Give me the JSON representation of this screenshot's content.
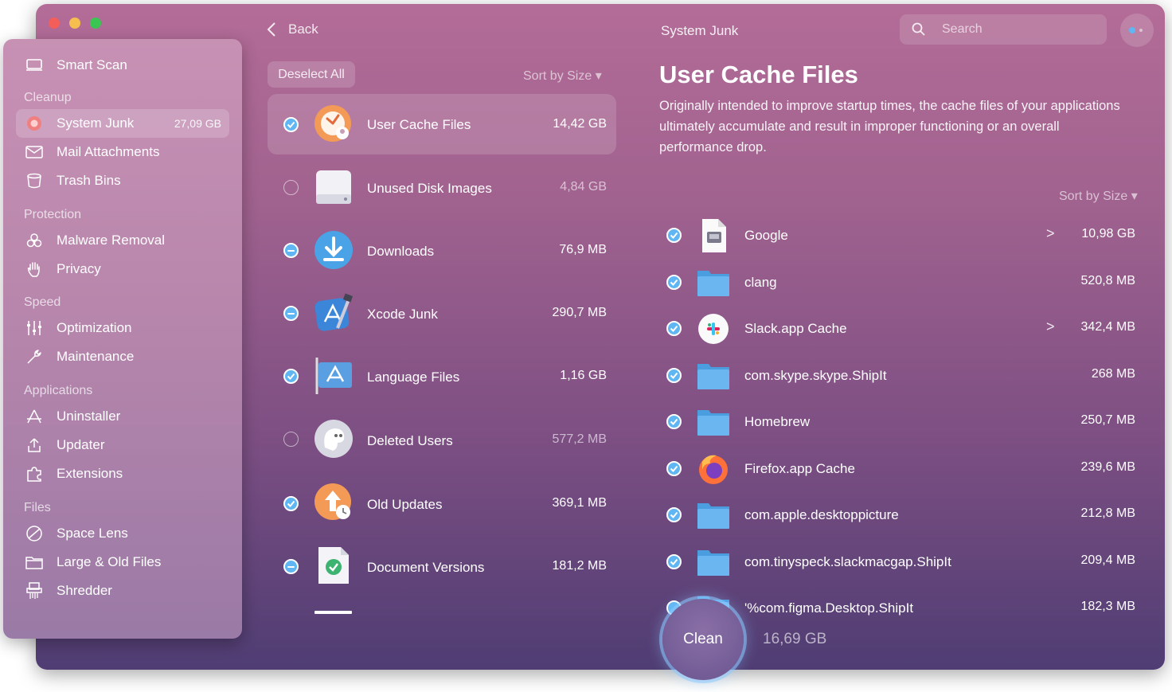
{
  "window": {
    "title": "System Junk",
    "back_label": "Back"
  },
  "search": {
    "placeholder": "Search"
  },
  "sidebar": {
    "smart_scan": "Smart Scan",
    "sections": [
      {
        "header": "Cleanup",
        "items": [
          {
            "label": "System Junk",
            "badge": "27,09 GB",
            "icon": "system-junk-icon"
          },
          {
            "label": "Mail Attachments",
            "icon": "mail-icon"
          },
          {
            "label": "Trash Bins",
            "icon": "trash-icon"
          }
        ]
      },
      {
        "header": "Protection",
        "items": [
          {
            "label": "Malware Removal",
            "icon": "biohazard-icon"
          },
          {
            "label": "Privacy",
            "icon": "hand-icon"
          }
        ]
      },
      {
        "header": "Speed",
        "items": [
          {
            "label": "Optimization",
            "icon": "sliders-icon"
          },
          {
            "label": "Maintenance",
            "icon": "wrench-icon"
          }
        ]
      },
      {
        "header": "Applications",
        "items": [
          {
            "label": "Uninstaller",
            "icon": "uninstaller-icon"
          },
          {
            "label": "Updater",
            "icon": "updater-icon"
          },
          {
            "label": "Extensions",
            "icon": "extensions-icon"
          }
        ]
      },
      {
        "header": "Files",
        "items": [
          {
            "label": "Space Lens",
            "icon": "space-lens-icon"
          },
          {
            "label": "Large & Old Files",
            "icon": "folder-icon"
          },
          {
            "label": "Shredder",
            "icon": "shredder-icon"
          }
        ]
      }
    ]
  },
  "categories": {
    "deselect_label": "Deselect All",
    "sort_label": "Sort by Size ▾",
    "items": [
      {
        "name": "User Cache Files",
        "size": "14,42 GB",
        "state": "on",
        "selected": true
      },
      {
        "name": "Unused Disk Images",
        "size": "4,84 GB",
        "state": "off"
      },
      {
        "name": "Downloads",
        "size": "76,9 MB",
        "state": "mixed"
      },
      {
        "name": "Xcode Junk",
        "size": "290,7 MB",
        "state": "mixed"
      },
      {
        "name": "Language Files",
        "size": "1,16 GB",
        "state": "on"
      },
      {
        "name": "Deleted Users",
        "size": "577,2 MB",
        "state": "off"
      },
      {
        "name": "Old Updates",
        "size": "369,1 MB",
        "state": "on"
      },
      {
        "name": "Document Versions",
        "size": "181,2 MB",
        "state": "mixed"
      }
    ]
  },
  "detail": {
    "title": "User Cache Files",
    "description": "Originally intended to improve startup times, the cache files of your applications ultimately accumulate and result in improper functioning or an overall performance drop.",
    "sort_label": "Sort by Size ▾",
    "files": [
      {
        "name": "Google",
        "size": "10,98 GB",
        "chevron": ">",
        "icon": "document-icon"
      },
      {
        "name": "clang",
        "size": "520,8 MB",
        "icon": "folder-icon"
      },
      {
        "name": "Slack.app Cache",
        "size": "342,4 MB",
        "chevron": ">",
        "icon": "slack-icon"
      },
      {
        "name": "com.skype.skype.ShipIt",
        "size": "268 MB",
        "icon": "folder-icon"
      },
      {
        "name": "Homebrew",
        "size": "250,7 MB",
        "icon": "folder-icon"
      },
      {
        "name": "Firefox.app Cache",
        "size": "239,6 MB",
        "icon": "firefox-icon"
      },
      {
        "name": "com.apple.desktoppicture",
        "size": "212,8 MB",
        "icon": "folder-icon"
      },
      {
        "name": "com.tinyspeck.slackmacgap.ShipIt",
        "size": "209,4 MB",
        "icon": "folder-icon"
      },
      {
        "name": "'%com.figma.Desktop.ShipIt",
        "size": "182,3 MB",
        "icon": "folder-icon"
      }
    ]
  },
  "footer": {
    "clean_label": "Clean",
    "total": "16,69 GB"
  },
  "colors": {
    "accent": "#5fb6f2",
    "close": "#f45e5a",
    "minimize": "#f6be4f",
    "zoom": "#3bc553"
  }
}
